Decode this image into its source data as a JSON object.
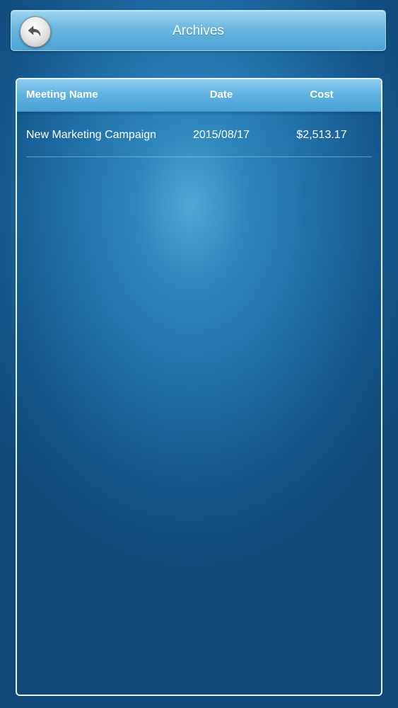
{
  "header": {
    "title": "Archives"
  },
  "table": {
    "columns": [
      "Meeting Name",
      "Date",
      "Cost"
    ],
    "rows": [
      {
        "name": "New Marketing Campaign",
        "date": "2015/08/17",
        "cost": "$2,513.17"
      }
    ]
  },
  "icons": {
    "back": "back-arrow-icon"
  },
  "colors": {
    "header_top": "#9ed4ef",
    "header_bottom": "#4fa3d6",
    "background_center": "#4ea7d6",
    "background_edge": "#0f4879"
  }
}
